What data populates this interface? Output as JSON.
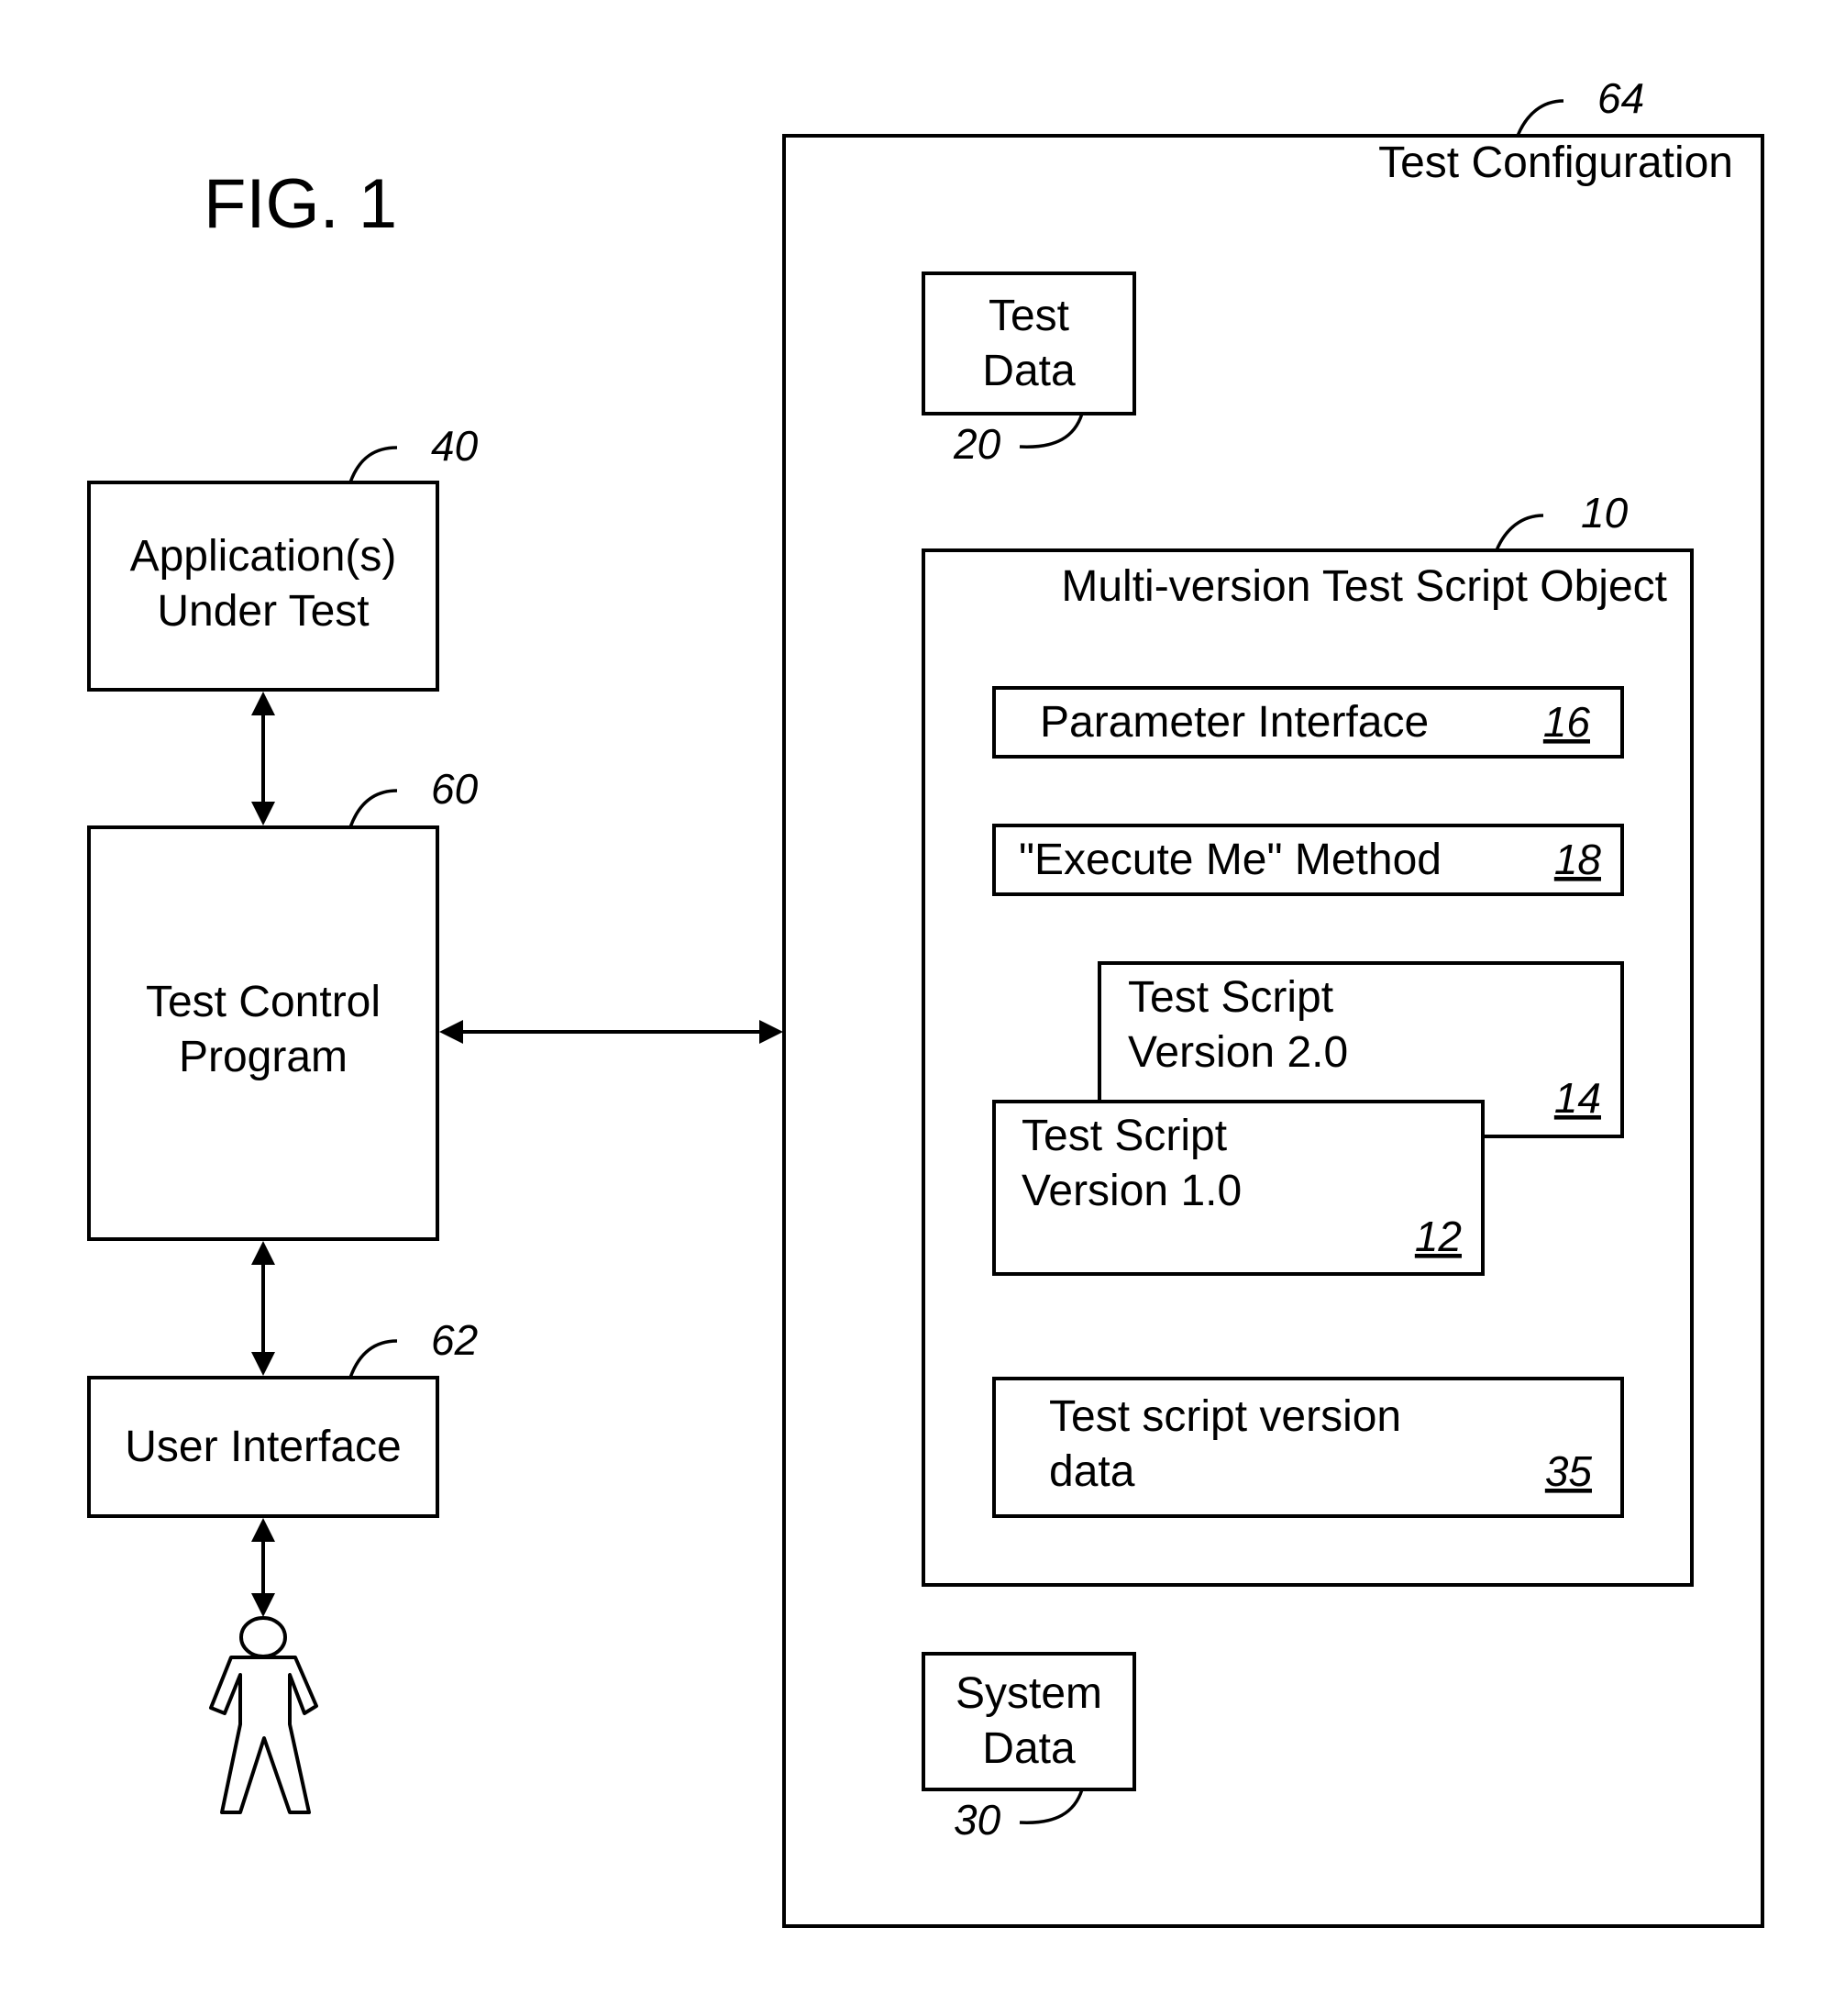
{
  "figure": {
    "title": "FIG. 1"
  },
  "left_column": {
    "application": {
      "lines": [
        "Application(s)",
        "Under Test"
      ],
      "ref": "40"
    },
    "test_control": {
      "lines": [
        "Test Control",
        "Program"
      ],
      "ref": "60"
    },
    "user_interface": {
      "lines": [
        "User Interface"
      ],
      "ref": "62"
    },
    "user_icon": "person-icon"
  },
  "test_configuration": {
    "title": "Test Configuration",
    "ref": "64",
    "test_data": {
      "lines": [
        "Test",
        "Data"
      ],
      "ref": "20"
    },
    "system_data": {
      "lines": [
        "System",
        "Data"
      ],
      "ref": "30"
    },
    "script_object": {
      "title": "Multi-version Test Script Object",
      "ref": "10",
      "parameter_interface": {
        "label": "Parameter Interface",
        "ref": "16"
      },
      "execute_method": {
        "label": "\"Execute Me\" Method",
        "ref": "18"
      },
      "script_v2": {
        "lines": [
          "Test Script",
          "Version 2.0"
        ],
        "ref": "14"
      },
      "script_v1": {
        "lines": [
          "Test Script",
          "Version 1.0"
        ],
        "ref": "12"
      },
      "version_data": {
        "lines": [
          "Test script version",
          "data"
        ],
        "ref": "35"
      }
    }
  },
  "connections": [
    {
      "from": "Application(s) Under Test",
      "to": "Test Control Program",
      "type": "bidirectional"
    },
    {
      "from": "Test Control Program",
      "to": "Test Configuration",
      "type": "bidirectional"
    },
    {
      "from": "Test Control Program",
      "to": "User Interface",
      "type": "bidirectional"
    },
    {
      "from": "User Interface",
      "to": "User",
      "type": "bidirectional"
    }
  ]
}
